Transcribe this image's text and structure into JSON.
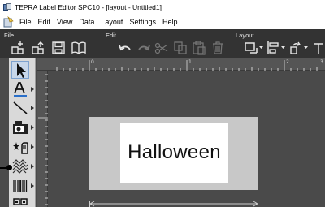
{
  "window": {
    "title": "TEPRA Label Editor SPC10 - [layout  - Untitled1]"
  },
  "menu": {
    "items": [
      "File",
      "Edit",
      "View",
      "Data",
      "Layout",
      "Settings",
      "Help"
    ]
  },
  "ribbon": {
    "groups": {
      "file": "File",
      "edit": "Edit",
      "layout": "Layout"
    },
    "icons": {
      "file": [
        "new-label-icon",
        "open-icon",
        "save-icon",
        "library-icon"
      ],
      "edit": [
        "undo-icon",
        "redo-icon",
        "cut-icon",
        "copy-icon",
        "paste-icon",
        "delete-icon"
      ],
      "layout": [
        "frame-icon",
        "align-icon",
        "rotate-icon"
      ]
    }
  },
  "ruler": {
    "top_marks": [
      "0",
      "1",
      "2",
      "3"
    ]
  },
  "tools": [
    "select-arrow-icon",
    "text-tool-icon",
    "line-tool-icon",
    "image-tool-icon",
    "symbol-tool-icon",
    "pattern-tool-icon",
    "barcode-tool-icon",
    "qr-code-tool-icon"
  ],
  "label": {
    "text": "Halloween"
  },
  "colors": {
    "ribbon_bg": "#333333",
    "workspace_bg": "#4a4a4a",
    "tape": "#c8c8c8",
    "label": "#ffffff",
    "toolbox": "#d9d9d9"
  }
}
